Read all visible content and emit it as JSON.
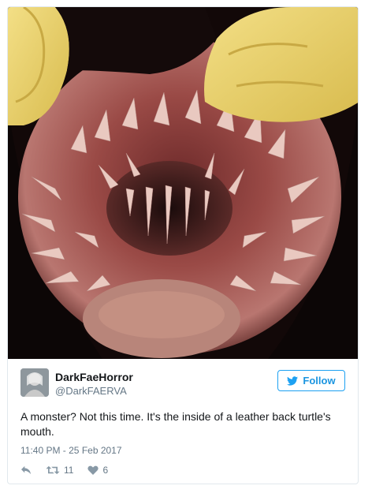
{
  "tweet": {
    "display_name": "DarkFaeHorror",
    "handle": "@DarkFAERVA",
    "follow_label": "Follow",
    "text": "A monster? Not this time. It's the inside of a leather back turtle's mouth.",
    "timestamp": "11:40 PM - 25 Feb 2017",
    "retweet_count": "11",
    "like_count": "6"
  },
  "icons": {
    "brand": "twitter-bird-icon",
    "reply": "reply-icon",
    "retweet": "retweet-icon",
    "like": "heart-icon"
  },
  "colors": {
    "accent": "#1da1f2",
    "muted_text": "#657786",
    "border": "#e1e8ed"
  }
}
